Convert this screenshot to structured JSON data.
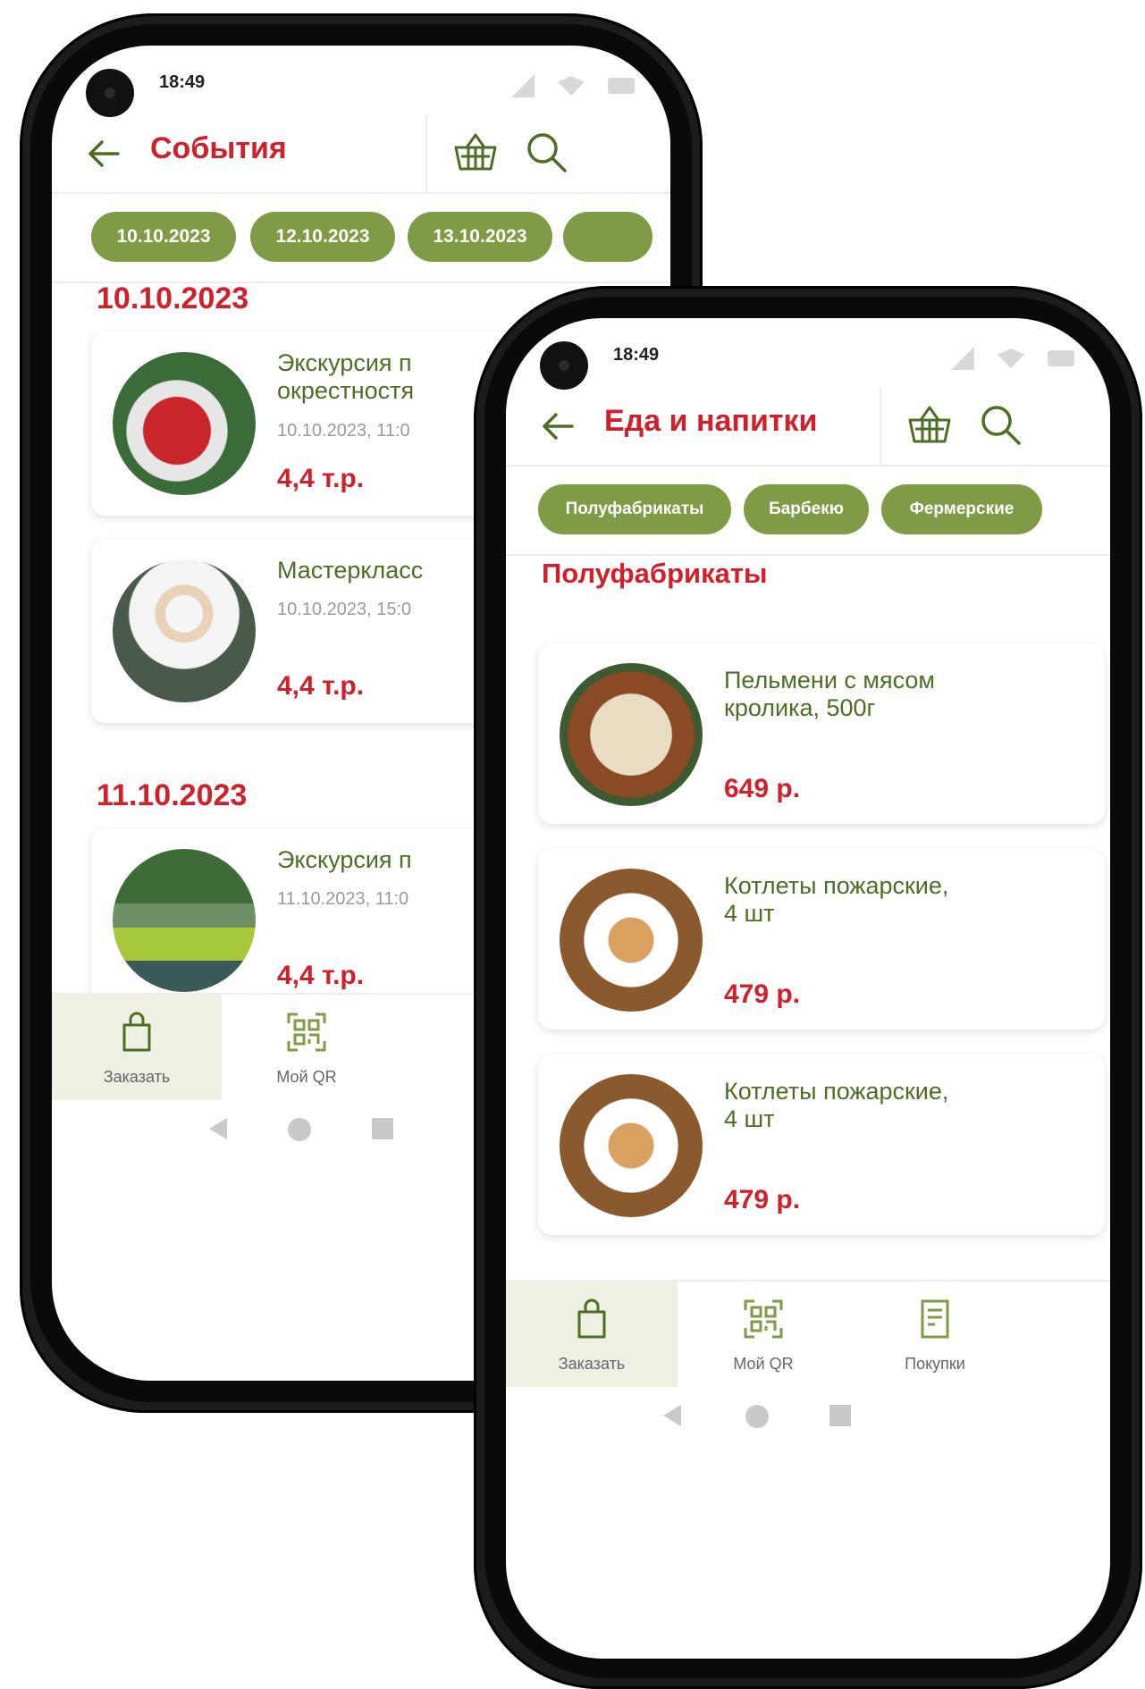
{
  "events_screen": {
    "status_time": "18:49",
    "title": "События",
    "date_chips": [
      "10.10.2023",
      "12.10.2023",
      "13.10.2023"
    ],
    "sections": [
      {
        "heading": "10.10.2023",
        "items": [
          {
            "name": "Экскурсия п\nокрестностя",
            "datetime": "10.10.2023, 11:0",
            "price": "4,4 т.р."
          },
          {
            "name": "Мастеркласс",
            "datetime": "10.10.2023, 15:0",
            "price": "4,4 т.р."
          }
        ]
      },
      {
        "heading": "11.10.2023",
        "items": [
          {
            "name": "Экскурсия п",
            "datetime": "11.10.2023, 11:0",
            "price": "4,4 т.р."
          }
        ]
      }
    ],
    "nav": {
      "order": "Заказать",
      "my_qr": "Мой QR"
    }
  },
  "food_screen": {
    "status_time": "18:49",
    "title": "Еда и напитки",
    "category_chips": [
      "Полуфабрикаты",
      "Барбекю",
      "Фермерские"
    ],
    "section_heading": "Полуфабрикаты",
    "items": [
      {
        "name": "Пельмени с мясом\nкролика, 500г",
        "price": "649 р."
      },
      {
        "name": "Котлеты пожарские,\n4 шт",
        "price": "479 р."
      },
      {
        "name": "Котлеты пожарские,\n4 шт",
        "price": "479 р."
      }
    ],
    "nav": {
      "order": "Заказать",
      "my_qr": "Мой QR",
      "purchases": "Покупки"
    }
  },
  "colors": {
    "accent_red": "#d0202c",
    "accent_green": "#7f9b45",
    "text_green": "#4d6e24"
  }
}
